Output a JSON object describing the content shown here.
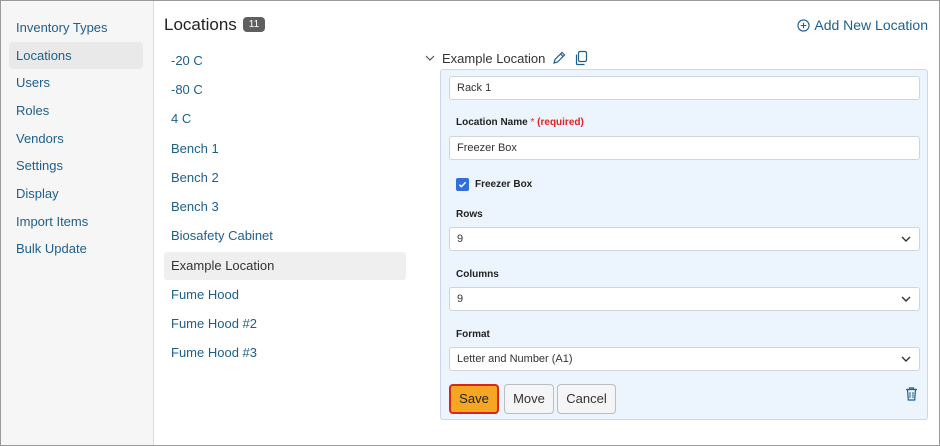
{
  "sidebar": {
    "items": [
      {
        "label": "Inventory Types"
      },
      {
        "label": "Locations"
      },
      {
        "label": "Users"
      },
      {
        "label": "Roles"
      },
      {
        "label": "Vendors"
      },
      {
        "label": "Settings"
      },
      {
        "label": "Display"
      },
      {
        "label": "Import Items"
      },
      {
        "label": "Bulk Update"
      }
    ],
    "active": "Locations"
  },
  "header": {
    "title": "Locations",
    "count": "11",
    "add_label": "Add New Location",
    "add_icon": "plus-circle-icon"
  },
  "locations": {
    "items": [
      {
        "label": "-20 C"
      },
      {
        "label": "-80 C"
      },
      {
        "label": "4 C"
      },
      {
        "label": "Bench 1"
      },
      {
        "label": "Bench 2"
      },
      {
        "label": "Bench 3"
      },
      {
        "label": "Biosafety Cabinet"
      },
      {
        "label": "Example Location"
      },
      {
        "label": "Fume Hood"
      },
      {
        "label": "Fume Hood #2"
      },
      {
        "label": "Fume Hood #3"
      }
    ],
    "selected": "Example Location"
  },
  "detail": {
    "title": "Example Location",
    "icons": [
      "chevron-down-icon",
      "pencil-icon",
      "copy-icon"
    ],
    "parent_value": "Rack 1",
    "name_label": "Location Name",
    "required_star": "*",
    "required_text": "(required)",
    "name_value": "Freezer Box",
    "freezer_box_label": "Freezer Box",
    "freezer_box_checked": true,
    "rows_label": "Rows",
    "rows_value": "9",
    "columns_label": "Columns",
    "columns_value": "9",
    "format_label": "Format",
    "format_value": "Letter and Number (A1)",
    "save_label": "Save",
    "move_label": "Move",
    "cancel_label": "Cancel",
    "delete_icon": "trash-icon"
  },
  "colors": {
    "link": "#1d5f8a",
    "save_bg": "#f5a623",
    "save_border": "#d9261c",
    "panel_bg": "#ecf4fd",
    "badge_bg": "#5f5f5f",
    "checkbox": "#2f6fd8"
  }
}
